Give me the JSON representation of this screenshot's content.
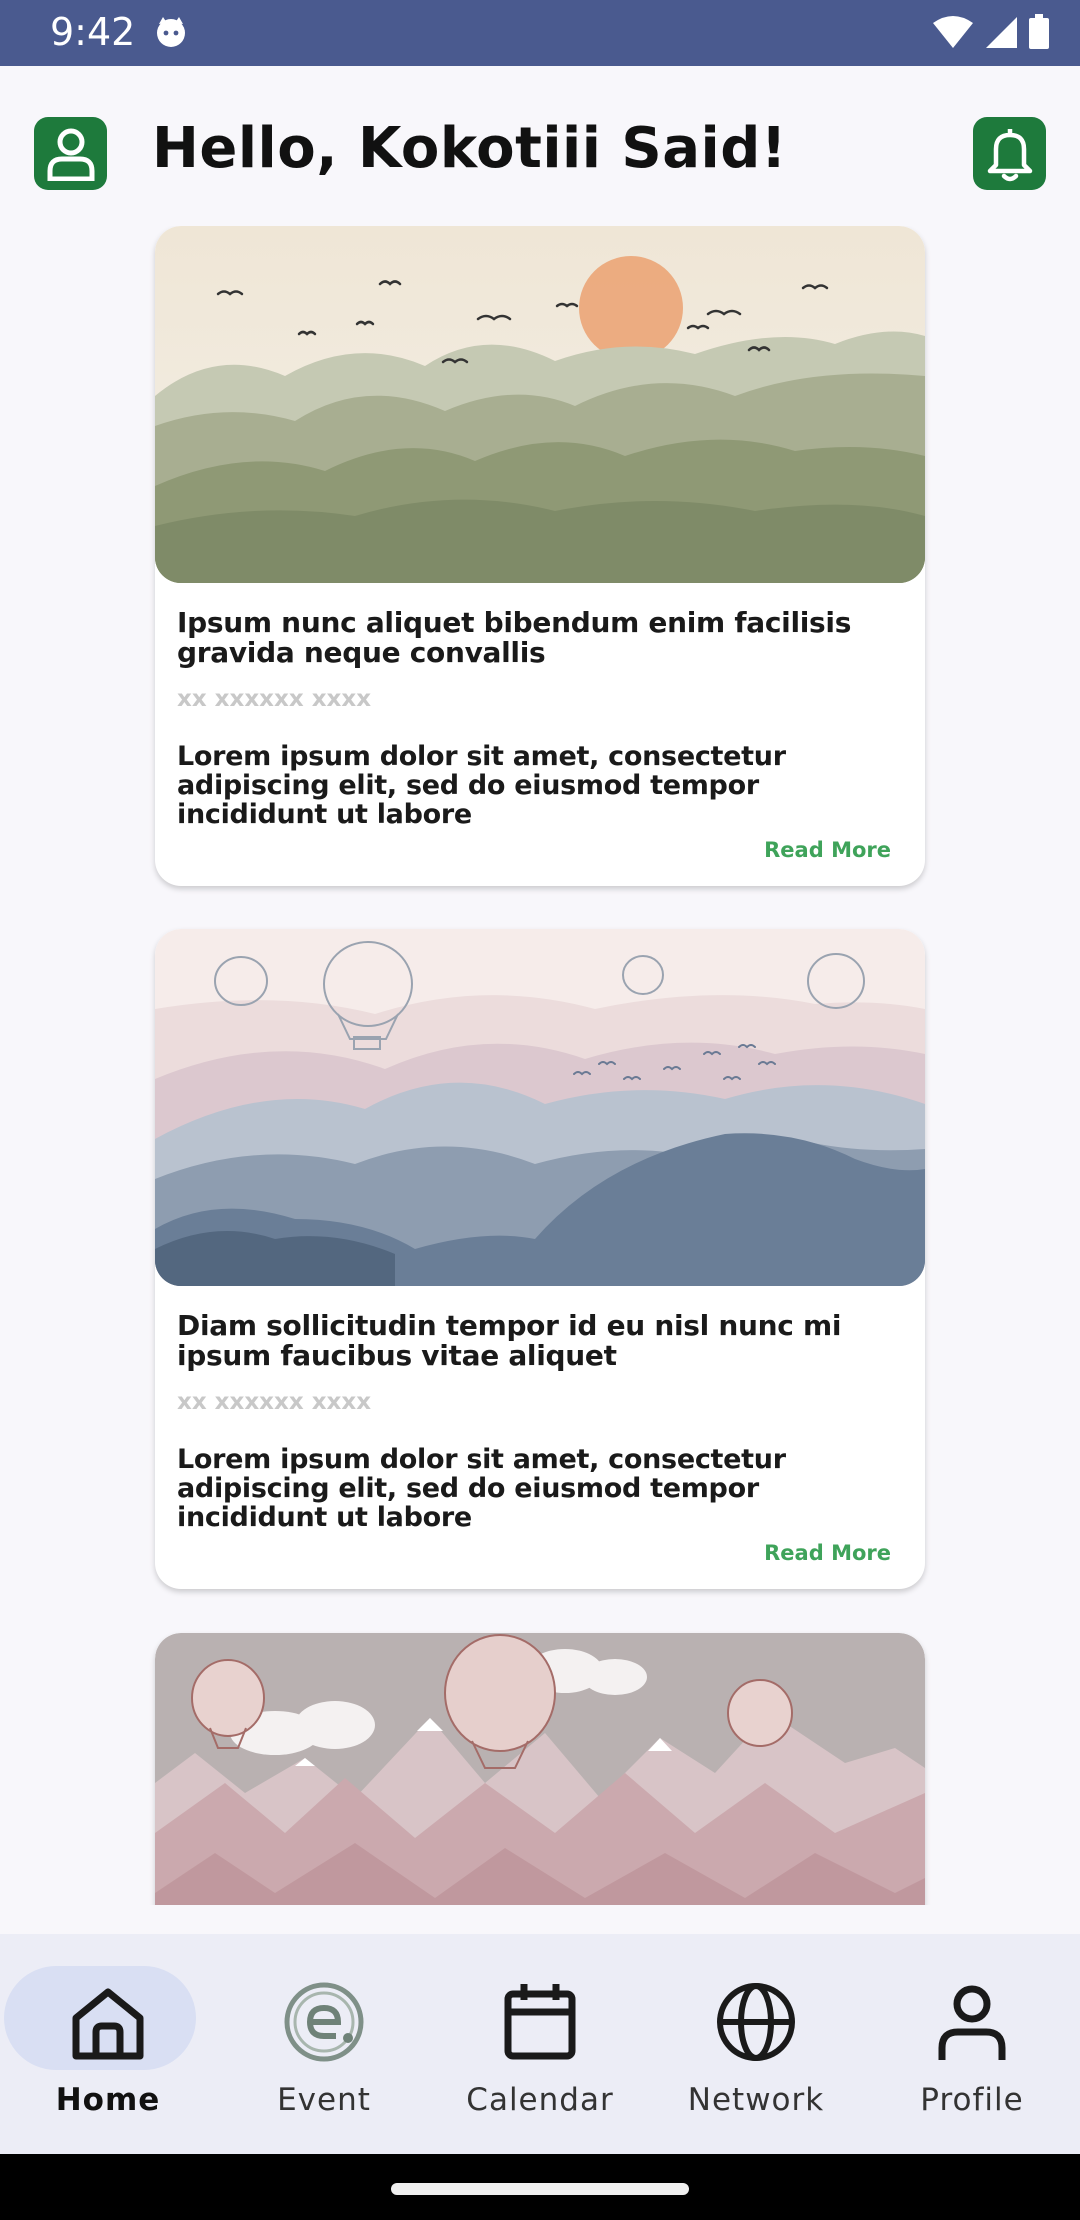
{
  "status_bar": {
    "time": "9:42"
  },
  "header": {
    "greeting": "Hello, Kokotiii Said!"
  },
  "cards": [
    {
      "title": "Ipsum nunc aliquet bibendum enim facilisis gravida neque convallis",
      "meta": "xx xxxxxx xxxx",
      "description": "Lorem ipsum dolor sit amet, consectetur adipiscing elit, sed do eiusmod tempor incididunt ut labore",
      "read_more": "Read More"
    },
    {
      "title": "Diam sollicitudin tempor id eu nisl nunc mi ipsum faucibus vitae aliquet",
      "meta": "xx xxxxxx xxxx",
      "description": "Lorem ipsum dolor sit amet, consectetur adipiscing elit, sed do eiusmod tempor incididunt ut labore",
      "read_more": "Read More"
    }
  ],
  "bottom_nav": {
    "items": [
      {
        "label": "Home",
        "icon": "home-icon",
        "active": true
      },
      {
        "label": "Event",
        "icon": "event-icon",
        "active": false
      },
      {
        "label": "Calendar",
        "icon": "calendar-icon",
        "active": false
      },
      {
        "label": "Network",
        "icon": "globe-icon",
        "active": false
      },
      {
        "label": "Profile",
        "icon": "person-icon",
        "active": false
      }
    ]
  },
  "colors": {
    "status_bar": "#4a5a8f",
    "accent_green": "#1e7a3c",
    "read_more": "#3fa35a",
    "nav_background": "#ecedf6",
    "nav_active_pill": "#d9dff3"
  }
}
